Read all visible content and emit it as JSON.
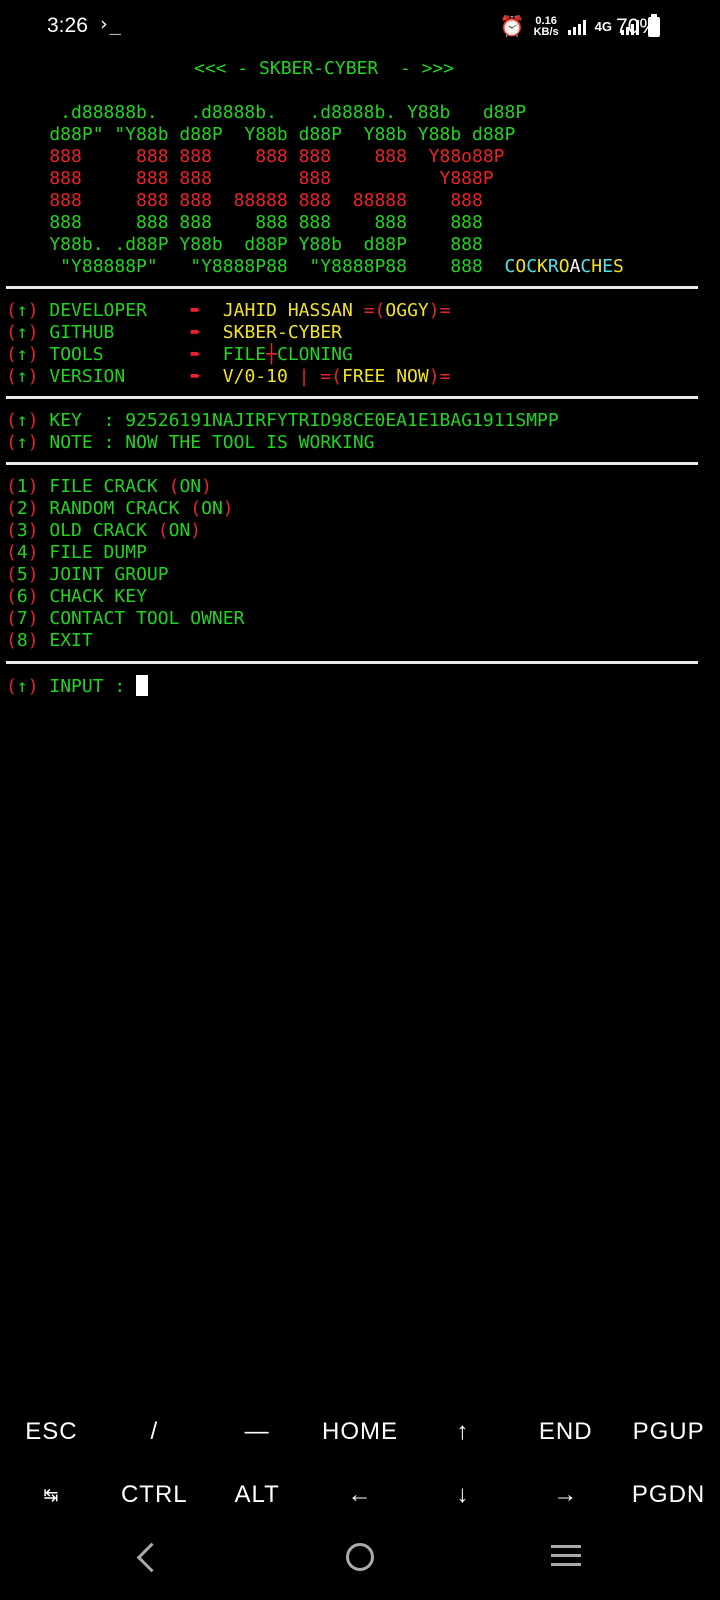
{
  "status": {
    "time": "3:26",
    "prompt_glyph": "›_",
    "net_speed_top": "0.16",
    "net_speed_bottom": "KB/s",
    "network": "4G",
    "battery": "70%"
  },
  "header": {
    "banner": "<<< - SKBER-CYBER  - >>>"
  },
  "ascii_logo": [
    "     .d88888b.   .d8888b.   .d8888b. Y88b   d88P",
    "    d88P\" \"Y88b d88P  Y88b d88P  Y88b Y88b d88P",
    "    888     888 888    888 888    888  Y88o88P",
    "    888     888 888        888          Y888P",
    "    888     888 888  88888 888  88888    888",
    "    888     888 888    888 888    888    888",
    "    Y88b. .d88P Y88b  d88P Y88b  d88P    888",
    "     \"Y88888P\"   \"Y8888P88  \"Y8888P88    888"
  ],
  "logo_tag": "COCKROACHES",
  "info": [
    {
      "label": "DEVELOPER",
      "value": "JAHID HASSAN",
      "extra": "OGGY"
    },
    {
      "label": "GITHUB",
      "value": "SKBER-CYBER"
    },
    {
      "label": "TOOLS",
      "value_a": "FILE",
      "sep": "┼",
      "value_b": "CLONING"
    },
    {
      "label": "VERSION",
      "value": "V/0-10",
      "extra": "FREE NOW"
    }
  ],
  "key_line": {
    "label": "KEY  ",
    "value": "92526191NAJIRFYTRID98CE0EA1E1BAG1911SMPP"
  },
  "note_line": {
    "label": "NOTE",
    "value": "NOW THE TOOL IS WORKING"
  },
  "menu": [
    {
      "num": "1",
      "label": "FILE CRACK",
      "status": "ON"
    },
    {
      "num": "2",
      "label": "RANDOM CRACK",
      "status": "ON"
    },
    {
      "num": "3",
      "label": "OLD CRACK",
      "status": "ON"
    },
    {
      "num": "4",
      "label": "FILE DUMP"
    },
    {
      "num": "5",
      "label": "JOINT GROUP"
    },
    {
      "num": "6",
      "label": "CHACK KEY"
    },
    {
      "num": "7",
      "label": "CONTACT TOOL OWNER"
    },
    {
      "num": "8",
      "label": "EXIT"
    }
  ],
  "input_label": "INPUT",
  "bullet": "↑",
  "arrow": "➨",
  "extra_keys": {
    "row1": [
      "ESC",
      "/",
      "—",
      "HOME",
      "↑",
      "END",
      "PGUP"
    ],
    "row2": [
      "↹",
      "CTRL",
      "ALT",
      "←",
      "↓",
      "→",
      "PGDN"
    ]
  },
  "colors": {
    "green": "#22d322",
    "red": "#e8232a",
    "yellow": "#f2e227"
  }
}
